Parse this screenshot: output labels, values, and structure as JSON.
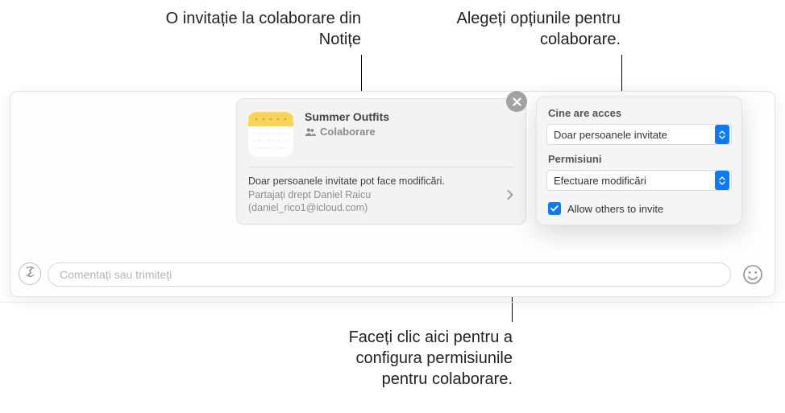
{
  "annotations": {
    "top_left": "O invitație la colaborare din Notițe",
    "top_right": "Alegeți opțiunile pentru colaborare.",
    "bottom": "Faceți clic aici pentru a configura permisiunile pentru colaborare."
  },
  "card": {
    "title": "Summer Outfits",
    "subtitle": "Colaborare",
    "info_line1": "Doar persoanele invitate pot face modificări.",
    "info_line2a": "Partajați drept Daniel Raicu",
    "info_line2b": "(daniel_rico1@icloud.com)"
  },
  "popover": {
    "access_label": "Cine are acces",
    "access_value": "Doar persoanele invitate",
    "perm_label": "Permisiuni",
    "perm_value": "Efectuare modificări",
    "allow_others": "Allow others to invite"
  },
  "input": {
    "placeholder": "Comentați sau trimiteți"
  }
}
